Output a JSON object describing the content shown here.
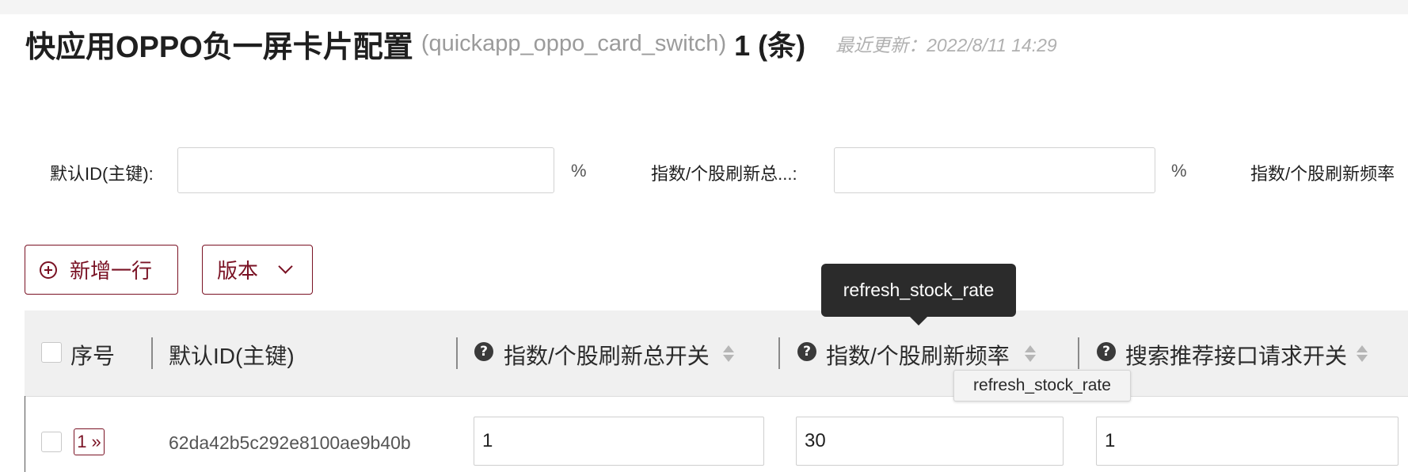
{
  "header": {
    "title": "快应用OPPO负一屏卡片配置",
    "code": "(quickapp_oppo_card_switch)",
    "count": "1 (条)",
    "updated": "最近更新：2022/8/11 14:29"
  },
  "filters": [
    {
      "label": "默认ID(主键):",
      "value": "",
      "suffix": "%"
    },
    {
      "label": "指数/个股刷新总...:",
      "value": "",
      "suffix": "%"
    },
    {
      "label": "指数/个股刷新频率"
    }
  ],
  "toolbar": {
    "add_row_label": "新增一行",
    "version_label": "版本"
  },
  "table": {
    "columns": [
      {
        "label": "序号"
      },
      {
        "label": "默认ID(主键)"
      },
      {
        "label": "指数/个股刷新总开关"
      },
      {
        "label": "指数/个股刷新频率"
      },
      {
        "label": "搜索推荐接口请求开关"
      }
    ],
    "rows": [
      {
        "index": "1 »",
        "id": "62da42b5c292e8100ae9b40b",
        "refresh_switch": "1",
        "refresh_rate": "30",
        "search_switch": "1"
      }
    ]
  },
  "tooltips": {
    "dark": "refresh_stock_rate",
    "light": "refresh_stock_rate"
  },
  "colors": {
    "accent": "#7a1224",
    "header_bg": "#f0f0f0",
    "tooltip_bg": "#2b2b2b"
  },
  "icons": [
    "circle-plus-icon",
    "chevron-down-icon",
    "question-circle-icon",
    "sort-icon"
  ]
}
